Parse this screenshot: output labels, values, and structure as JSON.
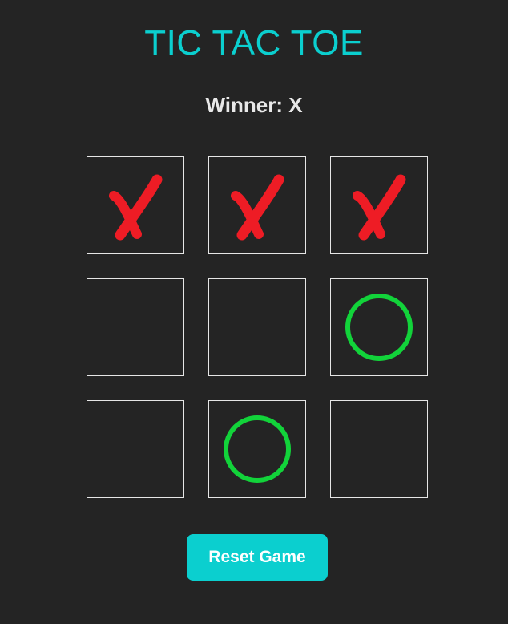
{
  "title": "TIC TAC TOE",
  "status": "Winner: X",
  "reset_label": "Reset Game",
  "colors": {
    "accent": "#0bcfcf",
    "x_mark": "#ee1c25",
    "o_mark": "#12d33a",
    "background": "#242424",
    "cell_border": "#e6e6e6",
    "text": "#e8e8e8"
  },
  "board": [
    "X",
    "X",
    "X",
    "",
    "",
    "O",
    "",
    "O",
    ""
  ]
}
